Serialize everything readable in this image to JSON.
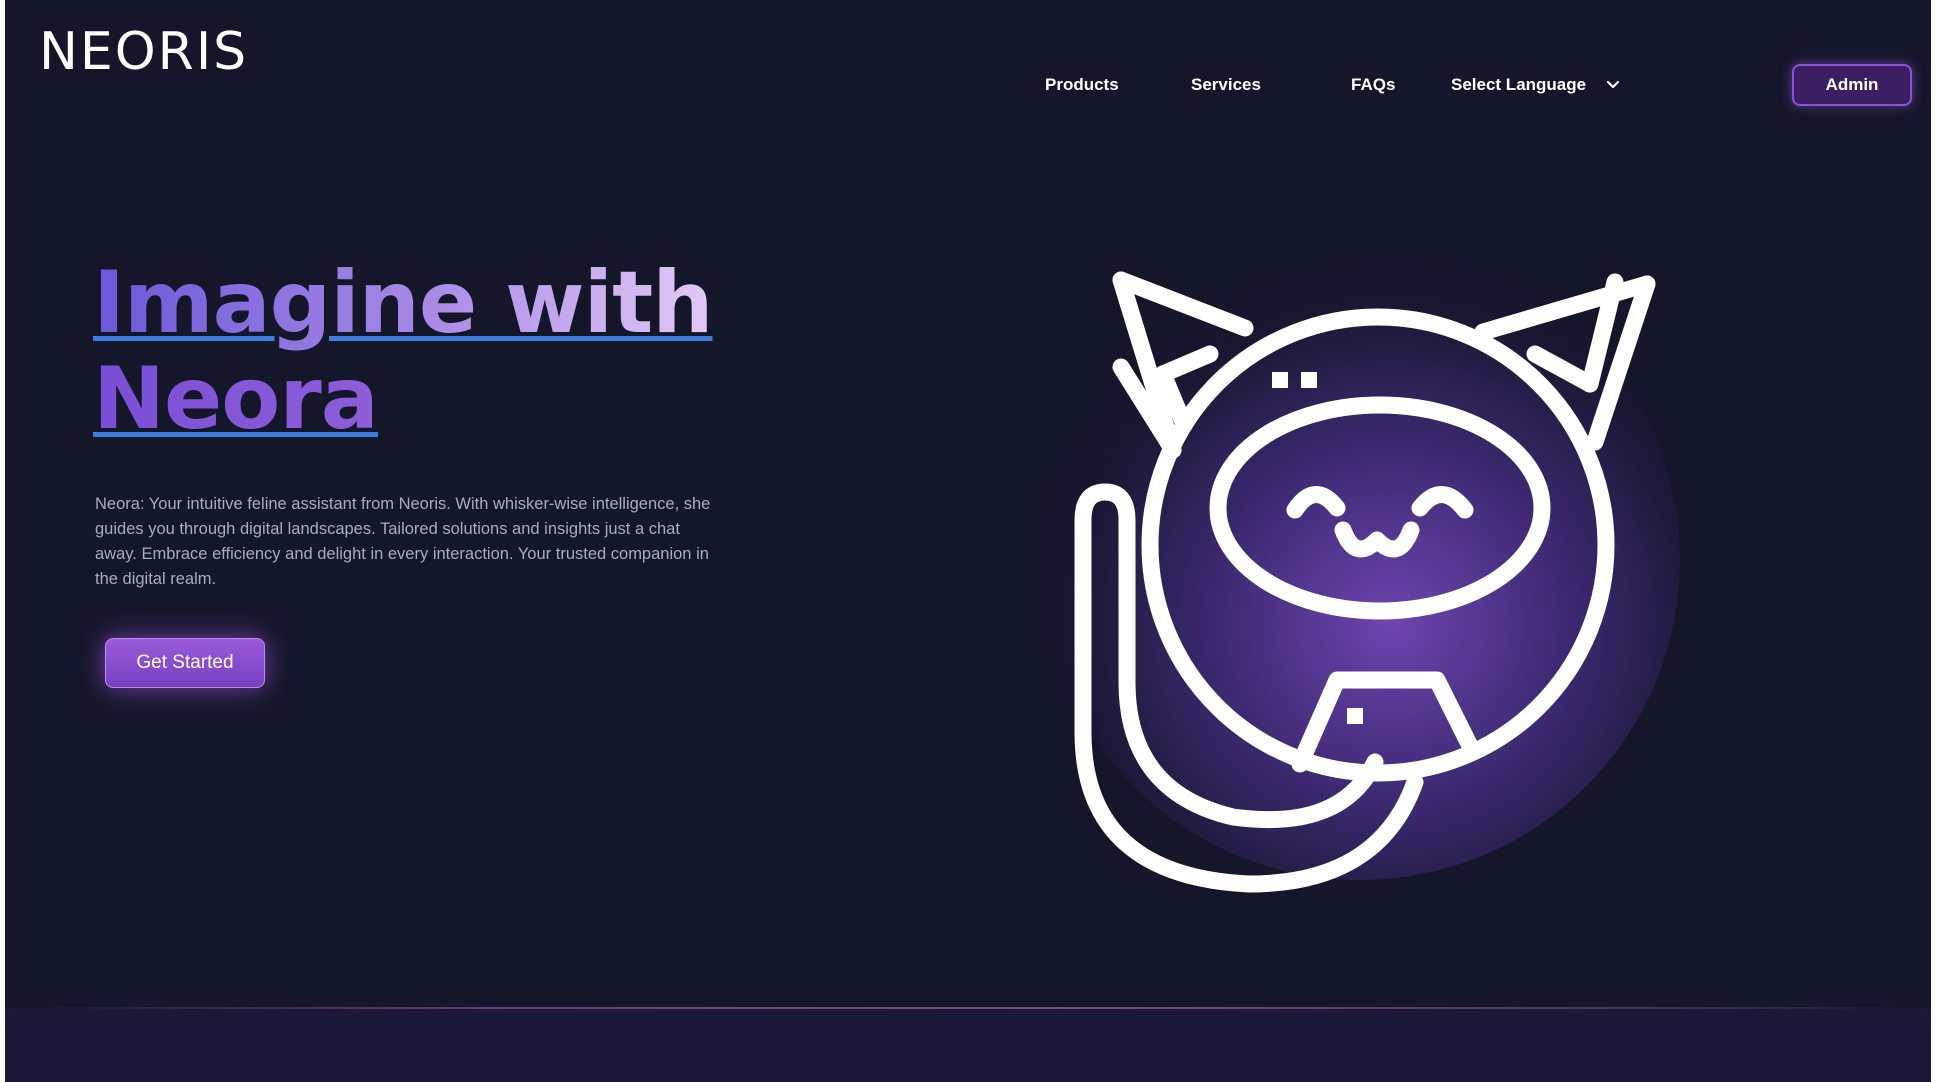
{
  "brand": {
    "logo_text": "NEORIS"
  },
  "nav": {
    "items": [
      {
        "label": "Products"
      },
      {
        "label": "Services"
      },
      {
        "label": "FAQs"
      }
    ],
    "language_select": {
      "label": "Select Language"
    },
    "admin_button": "Admin"
  },
  "hero": {
    "title_line1": "Imagine with",
    "title_line2": "Neora",
    "description": "Neora: Your intuitive feline assistant from Neoris. With whisker-wise intelligence, she guides you through digital landscapes. Tailored solutions and insights just a chat away. Embrace efficiency and delight in every interaction. Your trusted companion in the digital realm.",
    "cta_label": "Get Started"
  },
  "colors": {
    "background": "#141629",
    "accent": "#8a52d6",
    "title_gradient_start": "#6b58d8",
    "title_gradient_end": "#e2c9f6",
    "underline": "#3d7de0"
  },
  "icons": {
    "mascot": "neora-cat-robot-icon",
    "language_chevron": "chevron-down-icon"
  }
}
